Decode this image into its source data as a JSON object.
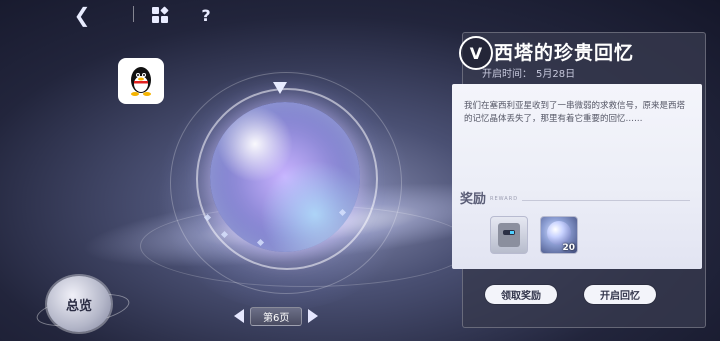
{
  "topbar": {
    "back_icon": "back-arrow-icon",
    "grid_icon": "grid-menu-icon",
    "help_label": "?"
  },
  "event": {
    "logo_letter": "V",
    "title": "西塔的珍贵回忆",
    "open_time_label": "开启时间：",
    "open_time_value": "5月28日",
    "description": "我们在塞西利亚星收到了一串微弱的求救信号，原来是西塔的记忆晶体丢失了，那里有着它重要的回忆……"
  },
  "rewards": {
    "title": "奖励",
    "subtitle": "REWARD",
    "items": [
      {
        "name": "robot-avatar",
        "count": ""
      },
      {
        "name": "memory-orb",
        "count": "20"
      }
    ]
  },
  "buttons": {
    "claim": "领取奖励",
    "start": "开启回忆"
  },
  "overview_label": "总览",
  "pager": {
    "label": "第6页"
  },
  "colors": {
    "panel": "#373a4e",
    "card": "#f4f5fb",
    "accent": "#ffffff"
  }
}
